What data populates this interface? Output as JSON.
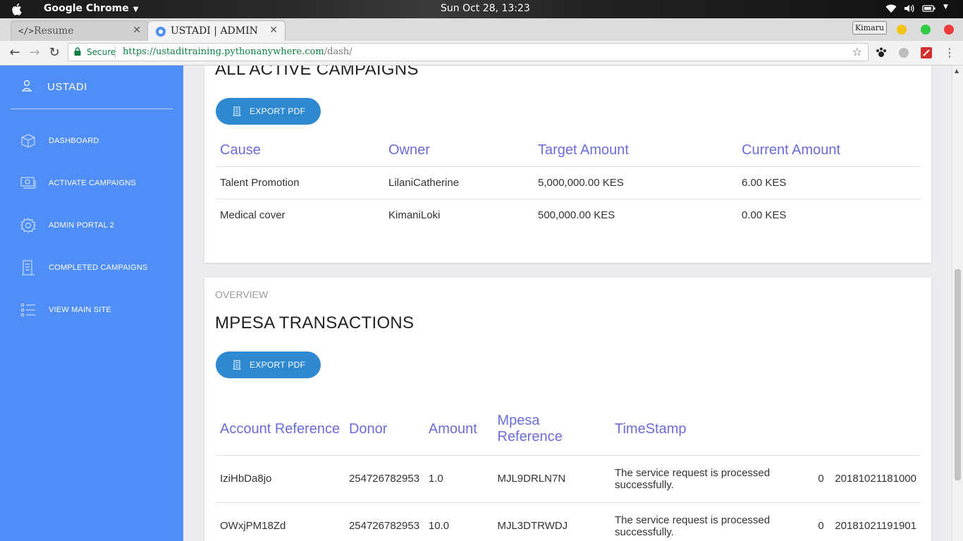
{
  "os": {
    "app_name": "Google Chrome",
    "clock": "Sun Oct 28, 13:23"
  },
  "browser": {
    "tabs": [
      {
        "label": "Resume",
        "icon": "code-icon",
        "active": false
      },
      {
        "label": "USTADI | ADMIN",
        "icon": "site-favicon",
        "active": true
      }
    ],
    "profile_name": "Kimaru",
    "secure_label": "Secure",
    "url_host": "https://ustaditraining.pythonanywhere.com",
    "url_path": "/dash/"
  },
  "sidebar": {
    "brand": "USTADI",
    "items": [
      {
        "label": "DASHBOARD",
        "icon": "cube-icon"
      },
      {
        "label": "ACTIVATE CAMPAIGNS",
        "icon": "money-icon"
      },
      {
        "label": "ADMIN PORTAL 2",
        "icon": "gear-icon"
      },
      {
        "label": "COMPLETED CAMPAIGNS",
        "icon": "receipt-icon"
      },
      {
        "label": "VIEW MAIN SITE",
        "icon": "list-icon"
      }
    ]
  },
  "campaigns": {
    "title": "ALL ACTIVE CAMPAIGNS",
    "export_label": "EXPORT PDF",
    "headers": [
      "Cause",
      "Owner",
      "Target Amount",
      "Current Amount"
    ],
    "rows": [
      [
        "Talent Promotion",
        "LilaniCatherine",
        "5,000,000.00 KES",
        "6.00 KES"
      ],
      [
        "Medical cover",
        "KimaniLoki",
        "500,000.00 KES",
        "0.00 KES"
      ]
    ]
  },
  "transactions": {
    "category": "OVERVIEW",
    "title": "MPESA TRANSACTIONS",
    "export_label": "EXPORT PDF",
    "headers": [
      "Account Reference",
      "Donor",
      "Amount",
      "Mpesa Reference",
      "TimeStamp",
      "",
      ""
    ],
    "rows": [
      [
        "IziHbDa8jo",
        "254726782953",
        "1.0",
        "MJL9DRLN7N",
        "The service request is processed successfully.",
        "0",
        "20181021181000"
      ],
      [
        "OWxjPM18Zd",
        "254726782953",
        "10.0",
        "MJL3DTRWDJ",
        "The service request is processed successfully.",
        "0",
        "20181021191901"
      ]
    ]
  },
  "colors": {
    "sidebar": "#4f8ef7",
    "button": "#2f89d1",
    "table_header": "#6b6cd9"
  }
}
